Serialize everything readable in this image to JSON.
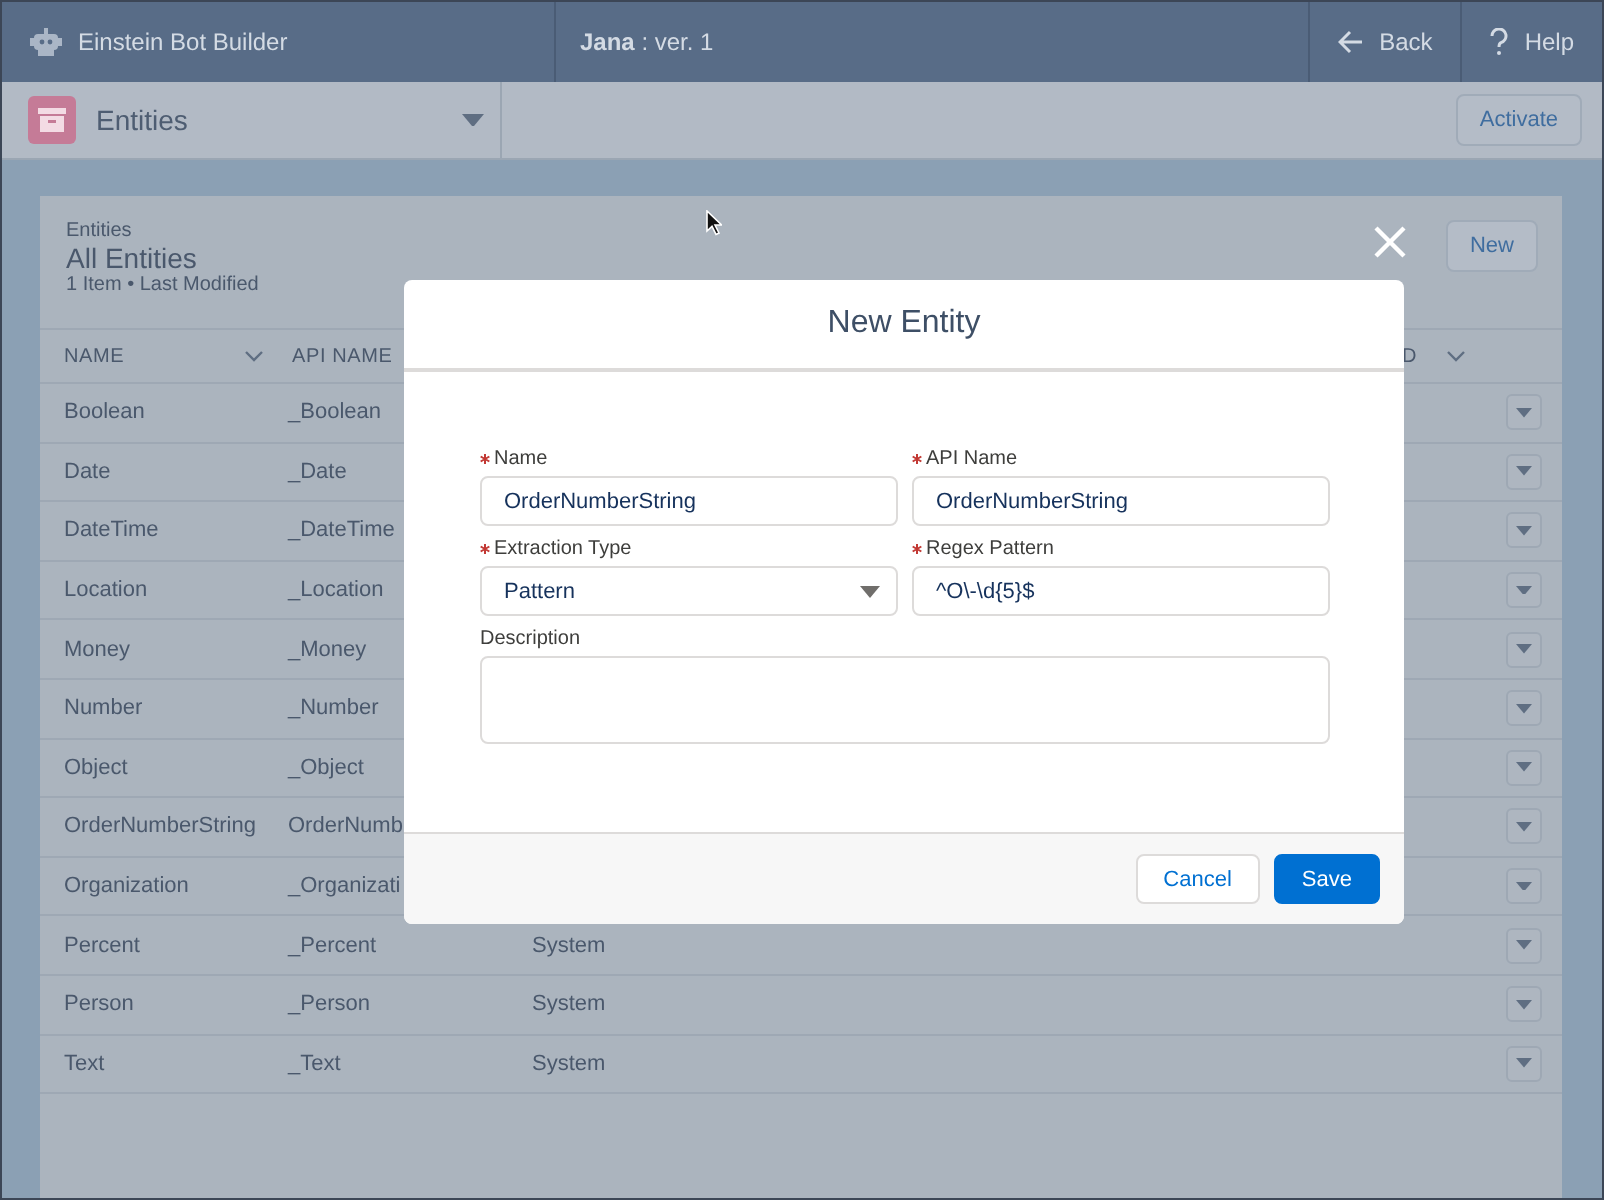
{
  "top_bar": {
    "app_name": "Einstein Bot Builder",
    "bot_version": "**Jana** : ver. 1",
    "actions": [
      {
        "label": "Back",
        "kind": "back"
      },
      {
        "label": "Help",
        "kind": "help"
      }
    ]
  },
  "object_bar": {
    "title": "Entities",
    "action": "Activate"
  },
  "list": {
    "object_label": "Entities",
    "title": "All Entities",
    "meta": "1 Item • Last Modified",
    "new_button": "New",
    "columns": [
      {
        "label": "NAME",
        "menu": true
      },
      {
        "label": "API NAME"
      },
      {
        "label": "D",
        "menu": true
      }
    ],
    "rows": [
      {
        "name": "Boolean",
        "api_name": "_Boolean"
      },
      {
        "name": "Date",
        "api_name": "_Date"
      },
      {
        "name": "DateTime",
        "api_name": "_DateTime"
      },
      {
        "name": "Location",
        "api_name": "_Location"
      },
      {
        "name": "Money",
        "api_name": "_Money"
      },
      {
        "name": "Number",
        "api_name": "_Number"
      },
      {
        "name": "Object",
        "api_name": "_Object"
      },
      {
        "name": "OrderNumberString",
        "api_name": "OrderNumb"
      },
      {
        "name": "Organization",
        "api_name": "_Organizati"
      },
      {
        "name": "Percent",
        "api_name": "_Percent",
        "type": "System"
      },
      {
        "name": "Person",
        "api_name": "_Person",
        "type": "System"
      },
      {
        "name": "Text",
        "api_name": "_Text",
        "type": "System"
      }
    ]
  },
  "modal": {
    "title": "New Entity",
    "fields": [
      {
        "kind": "text",
        "label": "Name",
        "required": true,
        "value": "OrderNumberString"
      },
      {
        "kind": "text",
        "label": "API Name",
        "required": true,
        "value": "OrderNumberString"
      },
      {
        "kind": "select",
        "label": "Extraction Type",
        "required": true,
        "value": "Pattern"
      },
      {
        "kind": "text",
        "label": "Regex Pattern",
        "required": true,
        "value": "^O\\-\\d{5}$"
      },
      {
        "kind": "textarea",
        "label": "Description",
        "required": false
      }
    ],
    "buttons": [
      {
        "label": "Cancel",
        "kind": "neutral"
      },
      {
        "label": "Save",
        "kind": "brand"
      }
    ]
  }
}
